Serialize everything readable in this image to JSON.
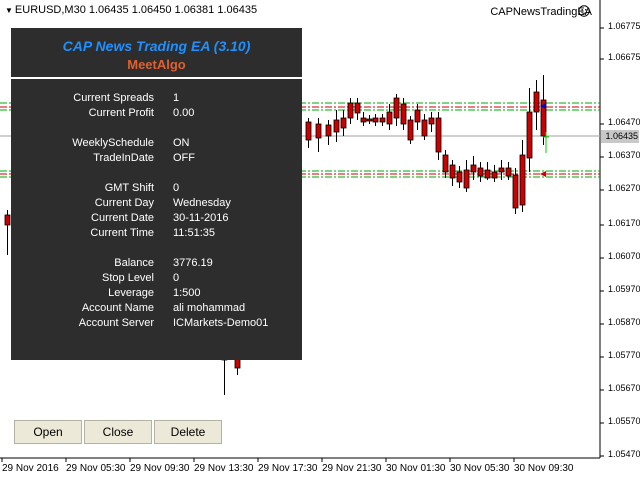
{
  "chart": {
    "symbol_label": "EURUSD,M30  1.06435 1.06450 1.06381 1.06435",
    "ea_name": "CAPNewsTradingEA",
    "current_price": "1.06435",
    "price_labels": [
      "1.06775",
      "1.06675",
      "1.06470",
      "1.06370",
      "1.06270",
      "1.06170",
      "1.06070",
      "1.05970",
      "1.05870",
      "1.05770",
      "1.05670",
      "1.05570",
      "1.05470"
    ],
    "time_labels": [
      "29 Nov 2016",
      "29 Nov 05:30",
      "29 Nov 09:30",
      "29 Nov 13:30",
      "29 Nov 17:30",
      "29 Nov 21:30",
      "30 Nov 01:30",
      "30 Nov 05:30",
      "30 Nov 09:30"
    ],
    "colors": {
      "bull_candle": "#ffffff",
      "bear_candle": "#cc0000",
      "level_green": "#00aa00",
      "level_red": "#cc0000"
    }
  },
  "panel": {
    "title": "CAP News Trading EA (3.10)",
    "subtitle": "MeetAlgo",
    "rows": [
      {
        "label": "Current Spreads",
        "value": "1"
      },
      {
        "label": "Current Profit",
        "value": "0.00"
      },
      {
        "label": "WeeklySchedule",
        "value": "ON"
      },
      {
        "label": "TradeInDate",
        "value": "OFF"
      },
      {
        "label": "GMT Shift",
        "value": "0"
      },
      {
        "label": "Current Day",
        "value": "Wednesday"
      },
      {
        "label": "Current Date",
        "value": "30-11-2016"
      },
      {
        "label": "Current Time",
        "value": "11:51:35"
      },
      {
        "label": "Balance",
        "value": "3776.19"
      },
      {
        "label": "Stop Level",
        "value": "0"
      },
      {
        "label": "Leverage",
        "value": "1:500"
      },
      {
        "label": "Account Name",
        "value": "ali mohammad"
      },
      {
        "label": "Account Server",
        "value": "ICMarkets-Demo01"
      }
    ]
  },
  "buttons": {
    "open": "Open",
    "close": "Close",
    "delete": "Delete"
  }
}
